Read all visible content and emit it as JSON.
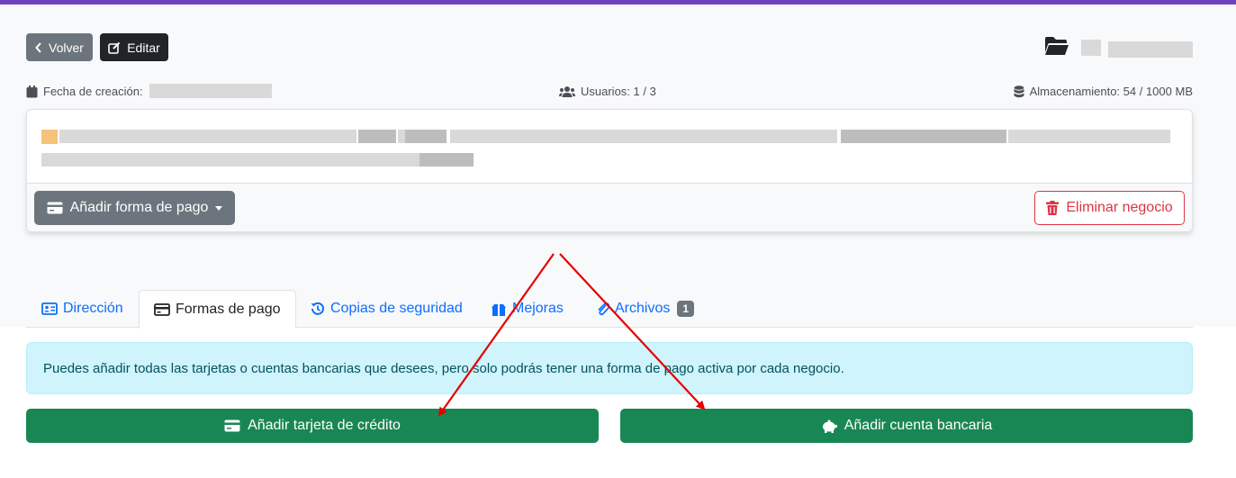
{
  "header": {
    "back_label": "Volver",
    "edit_label": "Editar"
  },
  "meta": {
    "created_label": "Fecha de creación:",
    "users_label": "Usuarios: 1 / 3",
    "storage_label": "Almacenamiento: 54 / 1000 MB"
  },
  "card": {
    "add_payment_label": "Añadir forma de pago",
    "delete_label": "Eliminar negocio"
  },
  "tabs": [
    {
      "label": "Dirección"
    },
    {
      "label": "Formas de pago"
    },
    {
      "label": "Copias de seguridad"
    },
    {
      "label": "Mejoras"
    },
    {
      "label": "Archivos",
      "badge": "1"
    }
  ],
  "alert": {
    "text": "Puedes añadir todas las tarjetas o cuentas bancarias que desees, pero solo podrás tener una forma de pago activa por cada negocio."
  },
  "actions": {
    "add_card_label": "Añadir tarjeta de crédito",
    "add_bank_label": "Añadir cuenta bancaria"
  },
  "colors": {
    "accent": "#6f42c1",
    "success": "#198754",
    "danger": "#dc3545",
    "link": "#0d6efd",
    "annotation": "#e60000"
  }
}
